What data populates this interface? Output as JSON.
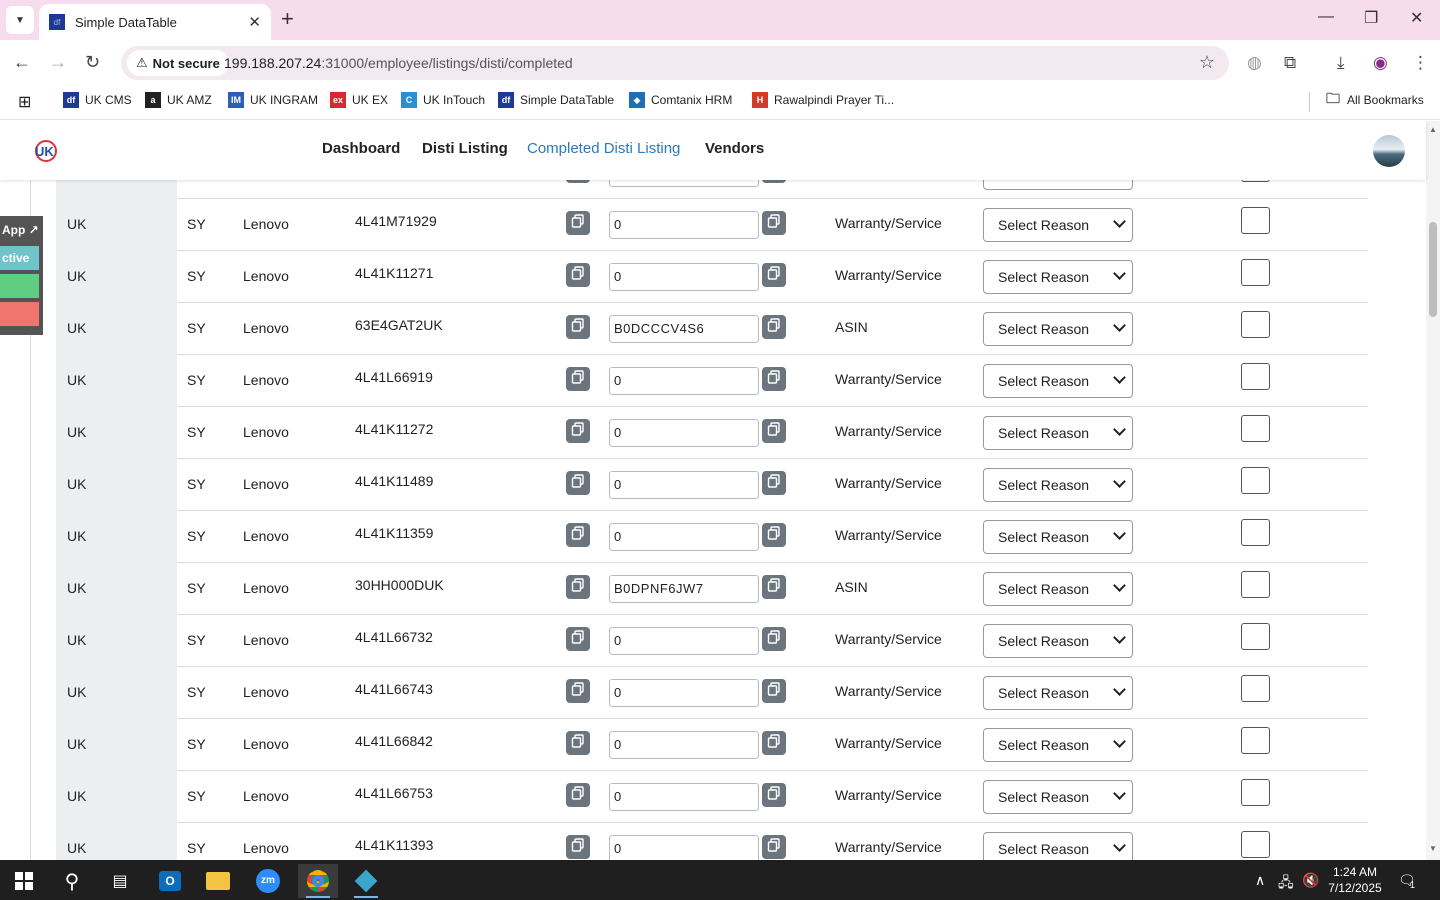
{
  "browser": {
    "tab_title": "Simple DataTable",
    "tab_favicon": "df",
    "security_label": "Not secure",
    "url_host": "199.188.207.24",
    "url_rest": ":31000/employee/listings/disti/completed",
    "bookmarks": [
      {
        "label": "UK CMS",
        "icon": "df",
        "color": "#1c3a94"
      },
      {
        "label": "UK AMZ",
        "icon": "a",
        "color": "#222222"
      },
      {
        "label": "UK INGRAM",
        "icon": "IM",
        "color": "#2b5fb8"
      },
      {
        "label": "UK EX",
        "icon": "ex",
        "color": "#d7282f"
      },
      {
        "label": "UK InTouch",
        "icon": "C",
        "color": "#2b8fd6"
      },
      {
        "label": "Simple DataTable",
        "icon": "df",
        "color": "#1c3a94"
      },
      {
        "label": "Comtanix HRM",
        "icon": "◆",
        "color": "#1f6fb5"
      },
      {
        "label": "Rawalpindi Prayer Ti...",
        "icon": "H",
        "color": "#d33a2c"
      }
    ],
    "all_bookmarks": "All Bookmarks"
  },
  "site": {
    "nav": [
      "Dashboard",
      "Disti Listing",
      "Completed Disti Listing",
      "Vendors"
    ],
    "active_nav": "Completed Disti Listing"
  },
  "side_widget": {
    "items": [
      {
        "label": "App ↗",
        "color": "#545454"
      },
      {
        "label": "ctive",
        "color": "#6fc3c9"
      },
      {
        "label": "",
        "color": "#5fce82"
      },
      {
        "label": "",
        "color": "#f0766d"
      }
    ]
  },
  "table": {
    "select_placeholder": "Select Reason",
    "rows": [
      {
        "region": "UK",
        "code": "SY",
        "brand": "Lenovo",
        "part": "4L41M71929",
        "value": "0",
        "type": "Warranty/Service"
      },
      {
        "region": "UK",
        "code": "SY",
        "brand": "Lenovo",
        "part": "4L41K11271",
        "value": "0",
        "type": "Warranty/Service"
      },
      {
        "region": "UK",
        "code": "SY",
        "brand": "Lenovo",
        "part": "63E4GAT2UK",
        "value": "B0DCCCV4S6",
        "type": "ASIN"
      },
      {
        "region": "UK",
        "code": "SY",
        "brand": "Lenovo",
        "part": "4L41L66919",
        "value": "0",
        "type": "Warranty/Service"
      },
      {
        "region": "UK",
        "code": "SY",
        "brand": "Lenovo",
        "part": "4L41K11272",
        "value": "0",
        "type": "Warranty/Service"
      },
      {
        "region": "UK",
        "code": "SY",
        "brand": "Lenovo",
        "part": "4L41K11489",
        "value": "0",
        "type": "Warranty/Service"
      },
      {
        "region": "UK",
        "code": "SY",
        "brand": "Lenovo",
        "part": "4L41K11359",
        "value": "0",
        "type": "Warranty/Service"
      },
      {
        "region": "UK",
        "code": "SY",
        "brand": "Lenovo",
        "part": "30HH000DUK",
        "value": "B0DPNF6JW7",
        "type": "ASIN"
      },
      {
        "region": "UK",
        "code": "SY",
        "brand": "Lenovo",
        "part": "4L41L66732",
        "value": "0",
        "type": "Warranty/Service"
      },
      {
        "region": "UK",
        "code": "SY",
        "brand": "Lenovo",
        "part": "4L41L66743",
        "value": "0",
        "type": "Warranty/Service"
      },
      {
        "region": "UK",
        "code": "SY",
        "brand": "Lenovo",
        "part": "4L41L66842",
        "value": "0",
        "type": "Warranty/Service"
      },
      {
        "region": "UK",
        "code": "SY",
        "brand": "Lenovo",
        "part": "4L41L66753",
        "value": "0",
        "type": "Warranty/Service"
      },
      {
        "region": "UK",
        "code": "SY",
        "brand": "Lenovo",
        "part": "4L41K11393",
        "value": "0",
        "type": "Warranty/Service"
      }
    ]
  },
  "taskbar": {
    "time": "1:24 AM",
    "date": "7/12/2025",
    "notification_count": "1"
  }
}
